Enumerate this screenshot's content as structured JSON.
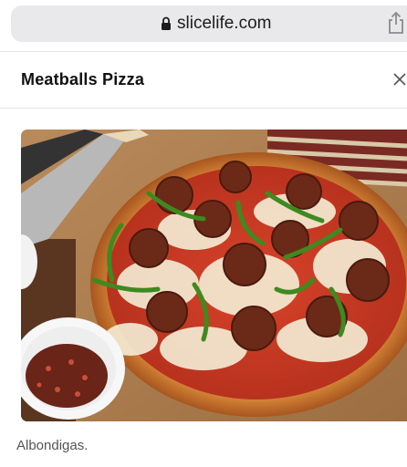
{
  "browser": {
    "url": "slicelife.com",
    "lock_icon": "lock-icon",
    "share_icon": "share-icon"
  },
  "modal": {
    "title": "Meatballs Pizza",
    "close_icon": "close-icon",
    "image_alt_icon": "pizza-photo",
    "caption": "Albondigas."
  },
  "colors": {
    "urlbar_bg": "#e9e9eb",
    "text_primary": "#111111",
    "caption": "#555555"
  }
}
